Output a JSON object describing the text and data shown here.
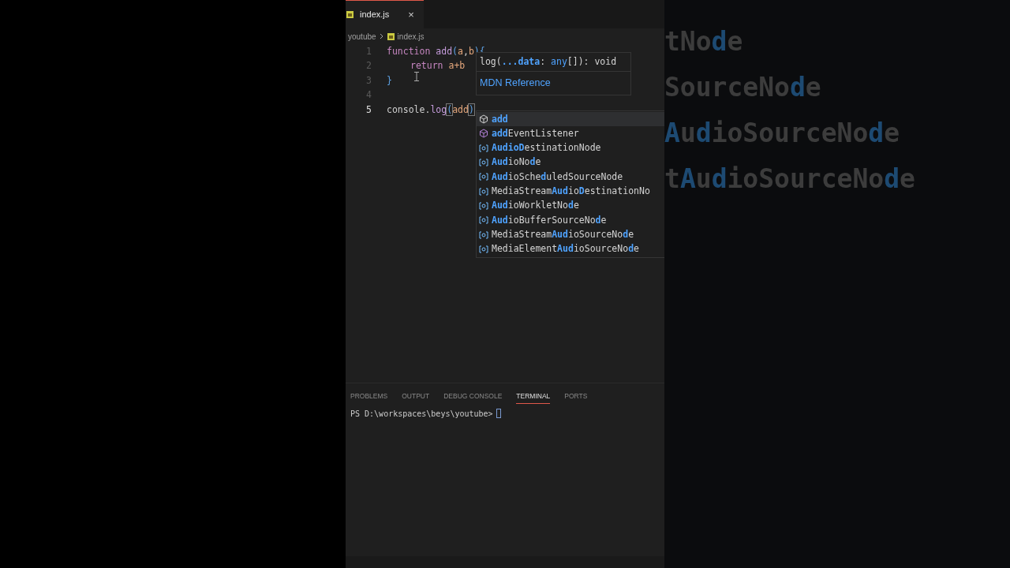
{
  "editor_tabs": [
    {
      "label": "index.js",
      "selected": true,
      "close": "×"
    }
  ],
  "breadcrumb": [
    "youtube",
    "index.js"
  ],
  "code_lines": [
    {
      "number": "1",
      "current": false,
      "tokens": [
        {
          "text": "function ",
          "kind": "keyword"
        },
        {
          "text": "add",
          "kind": "function"
        },
        {
          "text": "(",
          "kind": "bracket"
        },
        {
          "text": "a",
          "kind": "param"
        },
        {
          "text": ",",
          "kind": "plain"
        },
        {
          "text": "b",
          "kind": "param"
        },
        {
          "text": "){",
          "kind": "bracket"
        }
      ]
    },
    {
      "number": "2",
      "current": false,
      "indented": true,
      "tokens": [
        {
          "text": "return",
          "kind": "keyword"
        },
        {
          "text": " a+b",
          "kind": "param"
        }
      ]
    },
    {
      "number": "3",
      "current": false,
      "tokens": [
        {
          "text": "}",
          "kind": "bracket"
        }
      ]
    },
    {
      "number": "4",
      "current": false
    },
    {
      "number": "5",
      "current": true,
      "tokens": [
        {
          "text": "console",
          "kind": "plain"
        },
        {
          "text": ".",
          "kind": "plain"
        },
        {
          "text": "log",
          "kind": "method"
        },
        {
          "text": "(",
          "kind": "bracket_match"
        },
        {
          "text": "add",
          "kind": "param"
        },
        {
          "text": ")",
          "kind": "bracket_match"
        }
      ]
    }
  ],
  "signature_hint": {
    "parts": [
      {
        "text": "log(",
        "kind": "plain"
      },
      {
        "text": "...data",
        "kind": "active"
      },
      {
        "text": ": ",
        "kind": "plain"
      },
      {
        "text": "any",
        "kind": "type"
      },
      {
        "text": "[]",
        "kind": "plain"
      },
      {
        "text": "): void",
        "kind": "plain"
      }
    ],
    "link": "MDN Reference"
  },
  "suggestions": [
    {
      "kind": "method",
      "selected": true,
      "parts": [
        {
          "text": "add",
          "match": true
        }
      ]
    },
    {
      "kind": "method",
      "selected": false,
      "parts": [
        {
          "text": "add",
          "match": true
        },
        {
          "text": "EventListener",
          "match": false
        }
      ]
    },
    {
      "kind": "variable",
      "selected": false,
      "parts": [
        {
          "text": "AudioD",
          "match": true
        },
        {
          "text": "estinationNode",
          "match": false
        }
      ]
    },
    {
      "kind": "variable",
      "selected": false,
      "parts": [
        {
          "text": "Aud",
          "match": true
        },
        {
          "text": "ioNo",
          "match": false
        },
        {
          "text": "d",
          "match": true
        },
        {
          "text": "e",
          "match": false
        }
      ]
    },
    {
      "kind": "variable",
      "selected": false,
      "parts": [
        {
          "text": "Aud",
          "match": true
        },
        {
          "text": "ioSche",
          "match": false
        },
        {
          "text": "d",
          "match": true
        },
        {
          "text": "uledSourceNode",
          "match": false
        }
      ]
    },
    {
      "kind": "variable",
      "selected": false,
      "parts": [
        {
          "text": "MediaStream",
          "match": false
        },
        {
          "text": "Aud",
          "match": true
        },
        {
          "text": "io",
          "match": false
        },
        {
          "text": "D",
          "match": true
        },
        {
          "text": "estinationNo",
          "match": false
        }
      ]
    },
    {
      "kind": "variable",
      "selected": false,
      "parts": [
        {
          "text": "Aud",
          "match": true
        },
        {
          "text": "ioWorkletNo",
          "match": false
        },
        {
          "text": "d",
          "match": true
        },
        {
          "text": "e",
          "match": false
        }
      ]
    },
    {
      "kind": "variable",
      "selected": false,
      "parts": [
        {
          "text": "Aud",
          "match": true
        },
        {
          "text": "ioBufferSourceNo",
          "match": false
        },
        {
          "text": "d",
          "match": true
        },
        {
          "text": "e",
          "match": false
        }
      ]
    },
    {
      "kind": "variable",
      "selected": false,
      "parts": [
        {
          "text": "MediaStream",
          "match": false
        },
        {
          "text": "Aud",
          "match": true
        },
        {
          "text": "ioSourceNo",
          "match": false
        },
        {
          "text": "d",
          "match": true
        },
        {
          "text": "e",
          "match": false
        }
      ]
    },
    {
      "kind": "variable",
      "selected": false,
      "parts": [
        {
          "text": "MediaElement",
          "match": false
        },
        {
          "text": "Aud",
          "match": true
        },
        {
          "text": "ioSourceNo",
          "match": false
        },
        {
          "text": "d",
          "match": true
        },
        {
          "text": "e",
          "match": false
        }
      ]
    }
  ],
  "panel_tabs": [
    {
      "label": "PROBLEMS",
      "selected": false
    },
    {
      "label": "OUTPUT",
      "selected": false
    },
    {
      "label": "DEBUG CONSOLE",
      "selected": false
    },
    {
      "label": "TERMINAL",
      "selected": true
    },
    {
      "label": "PORTS",
      "selected": false
    }
  ],
  "terminal": {
    "prompt": "PS D:\\workspaces\\beys\\youtube>"
  },
  "backdrop_lines": [
    {
      "parts": [
        {
          "text": "tNo",
          "match": false
        },
        {
          "text": "d",
          "match": true
        },
        {
          "text": "e",
          "match": false
        }
      ]
    },
    {
      "parts": [
        {
          "text": "SourceNo",
          "match": false
        },
        {
          "text": "d",
          "match": true
        },
        {
          "text": "e",
          "match": false
        }
      ]
    },
    {
      "parts": [
        {
          "text": "A",
          "match": true
        },
        {
          "text": "u",
          "match": false
        },
        {
          "text": "d",
          "match": true
        },
        {
          "text": "ioSourceNo",
          "match": false
        },
        {
          "text": "d",
          "match": true
        },
        {
          "text": "e",
          "match": false
        }
      ]
    },
    {
      "parts": [
        {
          "text": "t",
          "match": false
        },
        {
          "text": "A",
          "match": true
        },
        {
          "text": "u",
          "match": false
        },
        {
          "text": "d",
          "match": true
        },
        {
          "text": "ioSourceNo",
          "match": false
        },
        {
          "text": "d",
          "match": true
        },
        {
          "text": "e",
          "match": false
        }
      ]
    }
  ]
}
